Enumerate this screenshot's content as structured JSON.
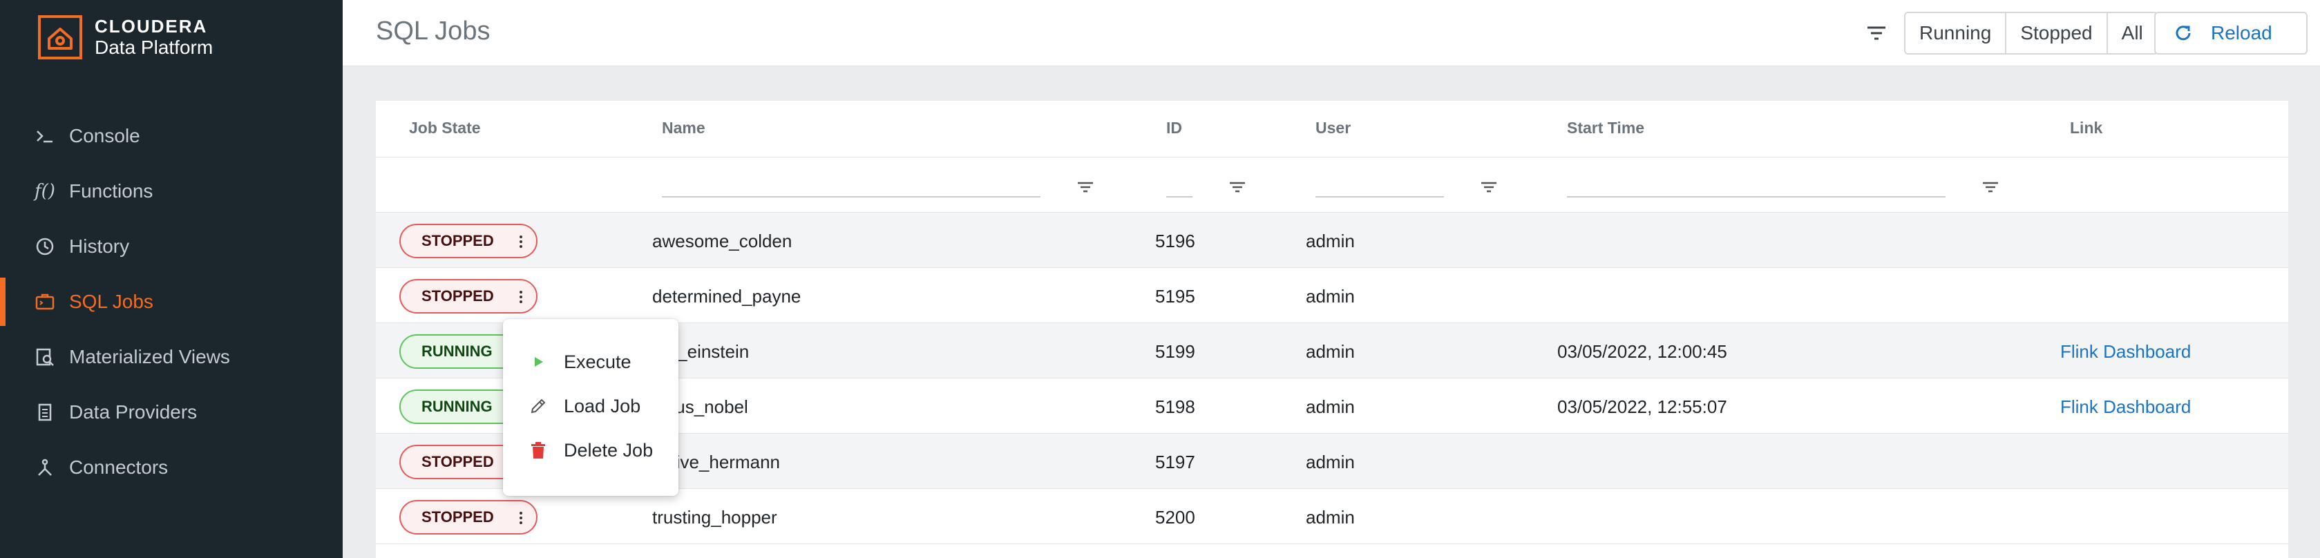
{
  "brand": {
    "line1": "CLOUDERA",
    "line2": "Data Platform",
    "accent": "#f36d23"
  },
  "sidebar": {
    "items": [
      {
        "label": "Console",
        "icon": "terminal-icon",
        "active": false
      },
      {
        "label": "Functions",
        "icon": "function-icon",
        "active": false
      },
      {
        "label": "History",
        "icon": "history-icon",
        "active": false
      },
      {
        "label": "SQL Jobs",
        "icon": "sql-jobs-icon",
        "active": true
      },
      {
        "label": "Materialized Views",
        "icon": "materialized-views-icon",
        "active": false
      },
      {
        "label": "Data Providers",
        "icon": "data-providers-icon",
        "active": false
      },
      {
        "label": "Connectors",
        "icon": "connectors-icon",
        "active": false
      }
    ]
  },
  "header": {
    "title": "SQL Jobs",
    "filters": [
      "Running",
      "Stopped",
      "All"
    ],
    "reload_label": "Reload"
  },
  "table": {
    "columns": [
      "Job State",
      "Name",
      "ID",
      "User",
      "Start Time",
      "Link"
    ],
    "rows": [
      {
        "state": "STOPPED",
        "name": "awesome_colden",
        "id": "5196",
        "user": "admin",
        "start": "",
        "link": ""
      },
      {
        "state": "STOPPED",
        "name": "determined_payne",
        "id": "5195",
        "user": "admin",
        "start": "",
        "link": ""
      },
      {
        "state": "RUNNING",
        "name": "ted_einstein",
        "id": "5199",
        "user": "admin",
        "start": "03/05/2022, 12:00:45",
        "link": "Flink Dashboard"
      },
      {
        "state": "RUNNING",
        "name": "cious_nobel",
        "id": "5198",
        "user": "admin",
        "start": "03/05/2022, 12:55:07",
        "link": "Flink Dashboard"
      },
      {
        "state": "STOPPED",
        "name": "ective_hermann",
        "id": "5197",
        "user": "admin",
        "start": "",
        "link": ""
      },
      {
        "state": "STOPPED",
        "name": "trusting_hopper",
        "id": "5200",
        "user": "admin",
        "start": "",
        "link": ""
      }
    ]
  },
  "context_menu": {
    "items": [
      {
        "label": "Execute",
        "icon": "play-icon"
      },
      {
        "label": "Load Job",
        "icon": "pencil-icon"
      },
      {
        "label": "Delete Job",
        "icon": "trash-icon"
      }
    ]
  },
  "colors": {
    "sidebar_bg": "#1b262d",
    "active": "#f36d23",
    "link": "#1a73c4",
    "stopped_border": "#e85a5a",
    "running_border": "#5fc35f"
  }
}
